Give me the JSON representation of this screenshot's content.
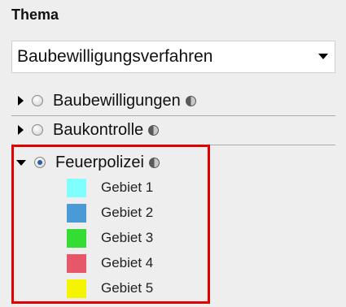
{
  "panel": {
    "title": "Thema"
  },
  "dropdown": {
    "selected": "Baubewilligungsverfahren"
  },
  "layers": [
    {
      "label": "Baubewilligungen",
      "expanded": false,
      "checked": false
    },
    {
      "label": "Baukontrolle",
      "expanded": false,
      "checked": false
    },
    {
      "label": "Feuerpolizei",
      "expanded": true,
      "checked": true
    }
  ],
  "legend": [
    {
      "label": "Gebiet 1",
      "color": "#80ffff"
    },
    {
      "label": "Gebiet 2",
      "color": "#4a9ad8"
    },
    {
      "label": "Gebiet 3",
      "color": "#33dd33"
    },
    {
      "label": "Gebiet 4",
      "color": "#e8566a"
    },
    {
      "label": "Gebiet 5",
      "color": "#f4f400"
    }
  ],
  "colors": {
    "highlight_border": "#e00000",
    "background": "#eeeeee"
  },
  "icons": {
    "info": "info-icon",
    "expand": "triangle-right-icon",
    "collapse": "triangle-down-icon"
  }
}
